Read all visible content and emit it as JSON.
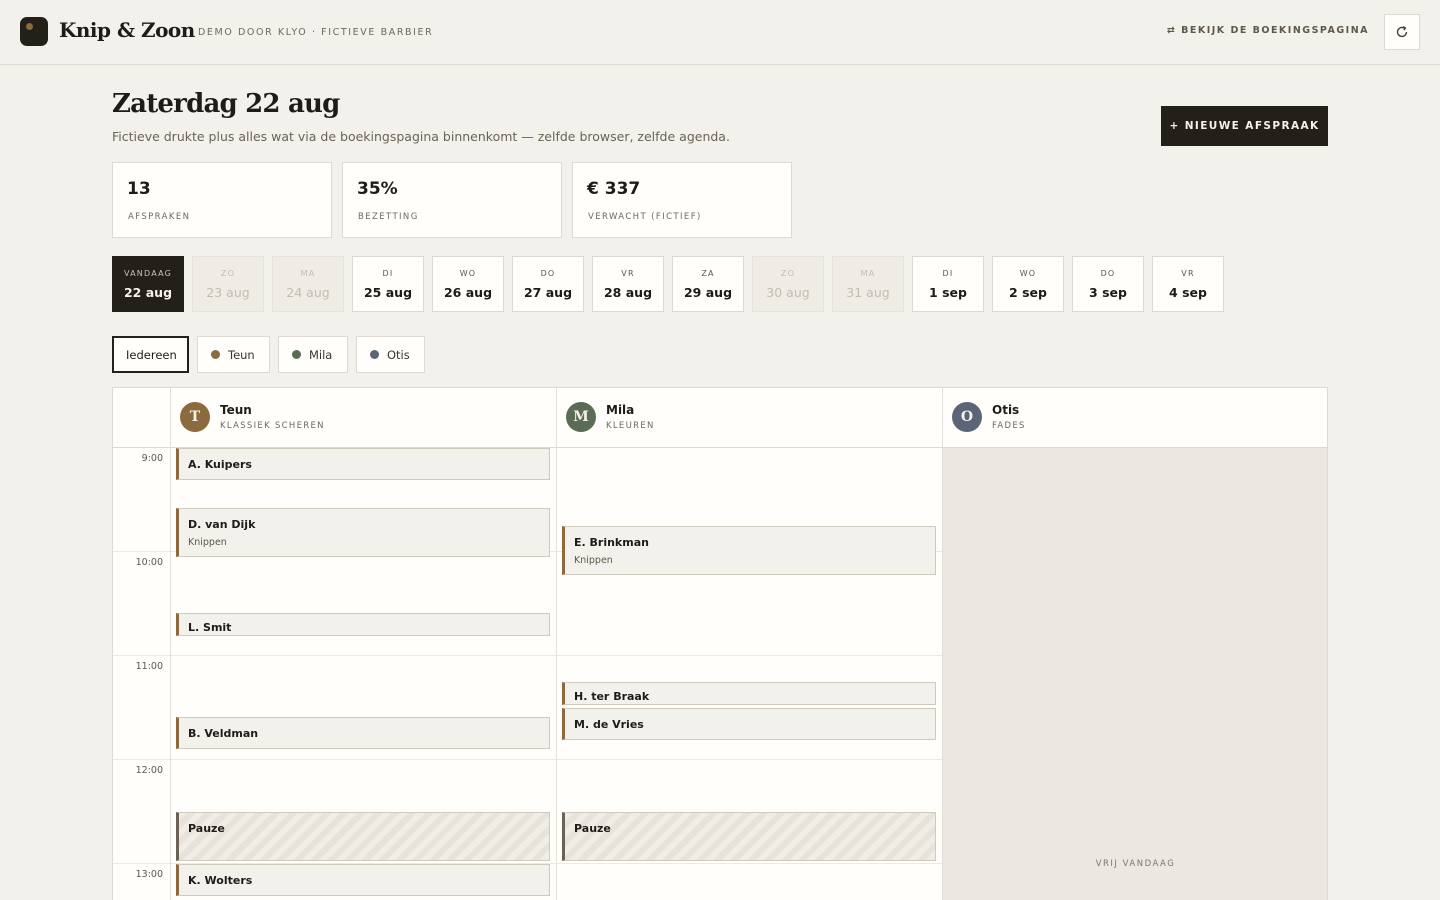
{
  "app": {
    "name": "Knip & Zoon",
    "tagline": "DEMO DOOR KLYO · FICTIEVE BARBIER",
    "booking_link": "⇄ BEKIJK DE BOEKINGSPAGINA"
  },
  "page": {
    "title": "Zaterdag 22 aug",
    "subtitle": "Fictieve drukte plus alles wat via de boekingspagina binnenkomt — zelfde browser, zelfde agenda.",
    "new_button": "+ NIEUWE AFSPRAAK"
  },
  "stats": [
    {
      "value": "13",
      "label": "AFSPRAKEN"
    },
    {
      "value": "35%",
      "label": "BEZETTING"
    },
    {
      "value": "€ 337",
      "label": "VERWACHT (FICTIEF)"
    }
  ],
  "days": [
    {
      "dow": "VANDAAG",
      "date": "22 aug",
      "state": "active"
    },
    {
      "dow": "ZO",
      "date": "23 aug",
      "state": "closed"
    },
    {
      "dow": "MA",
      "date": "24 aug",
      "state": "closed"
    },
    {
      "dow": "DI",
      "date": "25 aug",
      "state": "open"
    },
    {
      "dow": "WO",
      "date": "26 aug",
      "state": "open"
    },
    {
      "dow": "DO",
      "date": "27 aug",
      "state": "open"
    },
    {
      "dow": "VR",
      "date": "28 aug",
      "state": "open"
    },
    {
      "dow": "ZA",
      "date": "29 aug",
      "state": "open"
    },
    {
      "dow": "ZO",
      "date": "30 aug",
      "state": "closed"
    },
    {
      "dow": "MA",
      "date": "31 aug",
      "state": "closed"
    },
    {
      "dow": "DI",
      "date": "1 sep",
      "state": "open"
    },
    {
      "dow": "WO",
      "date": "2 sep",
      "state": "open"
    },
    {
      "dow": "DO",
      "date": "3 sep",
      "state": "open"
    },
    {
      "dow": "VR",
      "date": "4 sep",
      "state": "open"
    }
  ],
  "filters": [
    {
      "label": "Iedereen",
      "active": true,
      "color": ""
    },
    {
      "label": "Teun",
      "active": false,
      "color": "#8b6a3e"
    },
    {
      "label": "Mila",
      "active": false,
      "color": "#5b6b55"
    },
    {
      "label": "Otis",
      "active": false,
      "color": "#5c6478"
    }
  ],
  "calendar": {
    "times": [
      "9:00",
      "10:00",
      "11:00",
      "12:00",
      "13:00"
    ],
    "barbers": [
      {
        "initial": "T",
        "name": "Teun",
        "specialty": "KLASSIEK SCHEREN",
        "color": "#8b6a3e"
      },
      {
        "initial": "M",
        "name": "Mila",
        "specialty": "KLEUREN",
        "color": "#5b6b55"
      },
      {
        "initial": "O",
        "name": "Otis",
        "specialty": "FADES",
        "color": "#5c6478"
      }
    ],
    "off_label": "VRIJ VANDAAG",
    "appointments": {
      "teun": [
        {
          "name": "A. Kuipers",
          "service": ""
        },
        {
          "name": "D. van Dijk",
          "service": "Knippen"
        },
        {
          "name": "L. Smit",
          "service": ""
        },
        {
          "name": "B. Veldman",
          "service": ""
        },
        {
          "name": "Pauze",
          "service": ""
        },
        {
          "name": "K. Wolters",
          "service": ""
        }
      ],
      "mila": [
        {
          "name": "E. Brinkman",
          "service": "Knippen"
        },
        {
          "name": "H. ter Braak",
          "service": ""
        },
        {
          "name": "M. de Vries",
          "service": ""
        },
        {
          "name": "Pauze",
          "service": ""
        }
      ]
    }
  }
}
